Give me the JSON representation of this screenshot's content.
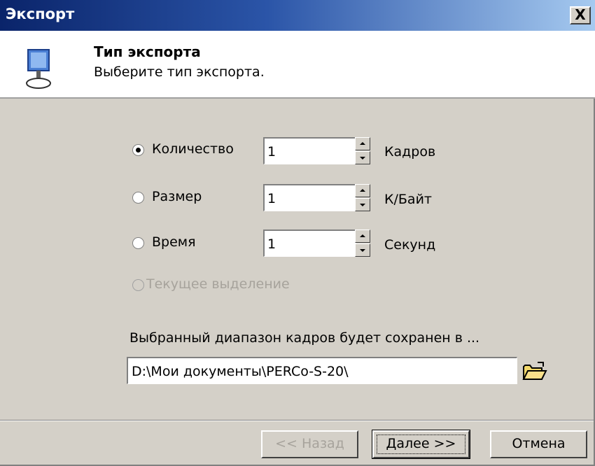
{
  "window": {
    "title": "Экспорт",
    "close_label": "X"
  },
  "header": {
    "title": "Тип экспорта",
    "subtitle": "Выберите тип экспорта."
  },
  "options": [
    {
      "label": "Количество",
      "selected": true,
      "enabled": true,
      "value": "1",
      "unit": "Кадров"
    },
    {
      "label": "Размер",
      "selected": false,
      "enabled": true,
      "value": "1",
      "unit": "К/Байт"
    },
    {
      "label": "Время",
      "selected": false,
      "enabled": true,
      "value": "1",
      "unit": "Секунд"
    },
    {
      "label": "Текущее выделение",
      "selected": false,
      "enabled": false
    }
  ],
  "destination": {
    "caption": "Выбранный диапазон кадров будет сохранен в ...",
    "path": "D:\\Мои документы\\PERCo-S-20\\"
  },
  "buttons": {
    "back": "<< Назад",
    "next": "Далее >>",
    "cancel": "Отмена"
  },
  "colors": {
    "titlebar_start": "#0a246a",
    "titlebar_end": "#a6caf0",
    "dialog_bg": "#d4d0c8"
  },
  "icons": {
    "header": "monitor-export-icon",
    "browse": "open-folder-icon"
  }
}
